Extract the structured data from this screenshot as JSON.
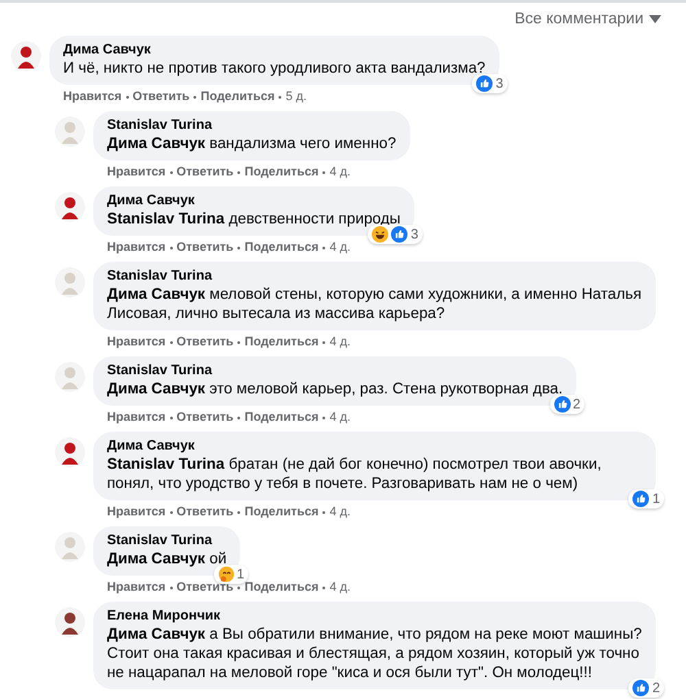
{
  "filter": {
    "label": "Все комментарии"
  },
  "comments": [
    {
      "author": "Дима Савчук",
      "color": "#c0161b",
      "text": "И чё, никто не против такого уродливого акта вандализма?",
      "reactions": [
        {
          "kind": "like"
        }
      ],
      "count": "3",
      "actions": [
        "Нравится",
        "Ответить",
        "Поделиться",
        "5 д."
      ],
      "replies": [
        {
          "author": "Stanislav Turina",
          "color": "#d9d2c8",
          "text": "**Дима Савчук** вандализма чего именно?",
          "actions": [
            "Нравится",
            "Ответить",
            "Поделиться",
            "4 д."
          ]
        },
        {
          "author": "Дима Савчук",
          "color": "#c0161b",
          "text": "**Stanislav Turina** девственности природы",
          "reactions": [
            {
              "kind": "haha"
            },
            {
              "kind": "like"
            }
          ],
          "count": "3",
          "actions": [
            "Нравится",
            "Ответить",
            "Поделиться",
            "4 д."
          ]
        },
        {
          "author": "Stanislav Turina",
          "color": "#d9d2c8",
          "text": "**Дима Савчук** меловой стены, которую сами художники, а именно Наталья Лисовая, лично вытесала из массива карьера?",
          "actions": [
            "Нравится",
            "Ответить",
            "Поделиться",
            "4 д."
          ]
        },
        {
          "author": "Stanislav Turina",
          "color": "#d9d2c8",
          "text": "**Дима Савчук** это меловой карьер, раз. Стена рукотворная два.",
          "reactions": [
            {
              "kind": "like"
            }
          ],
          "count": "2",
          "actions": [
            "Нравится",
            "Ответить",
            "Поделиться",
            "4 д."
          ]
        },
        {
          "author": "Дима Савчук",
          "color": "#c0161b",
          "text": "**Stanislav Turina** братан (не дай бог конечно) посмотрел твои авочки, понял, что уродство у тебя в почете. Разговаривать нам не о чем)",
          "reactions": [
            {
              "kind": "like"
            }
          ],
          "count": "1",
          "actions": [
            "Нравится",
            "Ответить",
            "Поделиться",
            "4 д."
          ]
        },
        {
          "author": "Stanislav Turina",
          "color": "#d9d2c8",
          "text": "**Дима Савчук** ой",
          "reactions": [
            {
              "kind": "hug"
            }
          ],
          "count": "1",
          "actions": [
            "Нравится",
            "Ответить",
            "Поделиться",
            "4 д."
          ]
        },
        {
          "author": "Елена Мирончик",
          "color": "#8a3a32",
          "text": "**Дима Савчук** а Вы обратили внимание, что рядом на реке моют машины? Стоит она такая красивая и блестящая, а рядом хозяин, который уж точно не нацарапал на меловой горе \"киса и ося были тут\". Он молодец!!!",
          "reactions": [
            {
              "kind": "like"
            }
          ],
          "count": "2"
        }
      ]
    }
  ]
}
